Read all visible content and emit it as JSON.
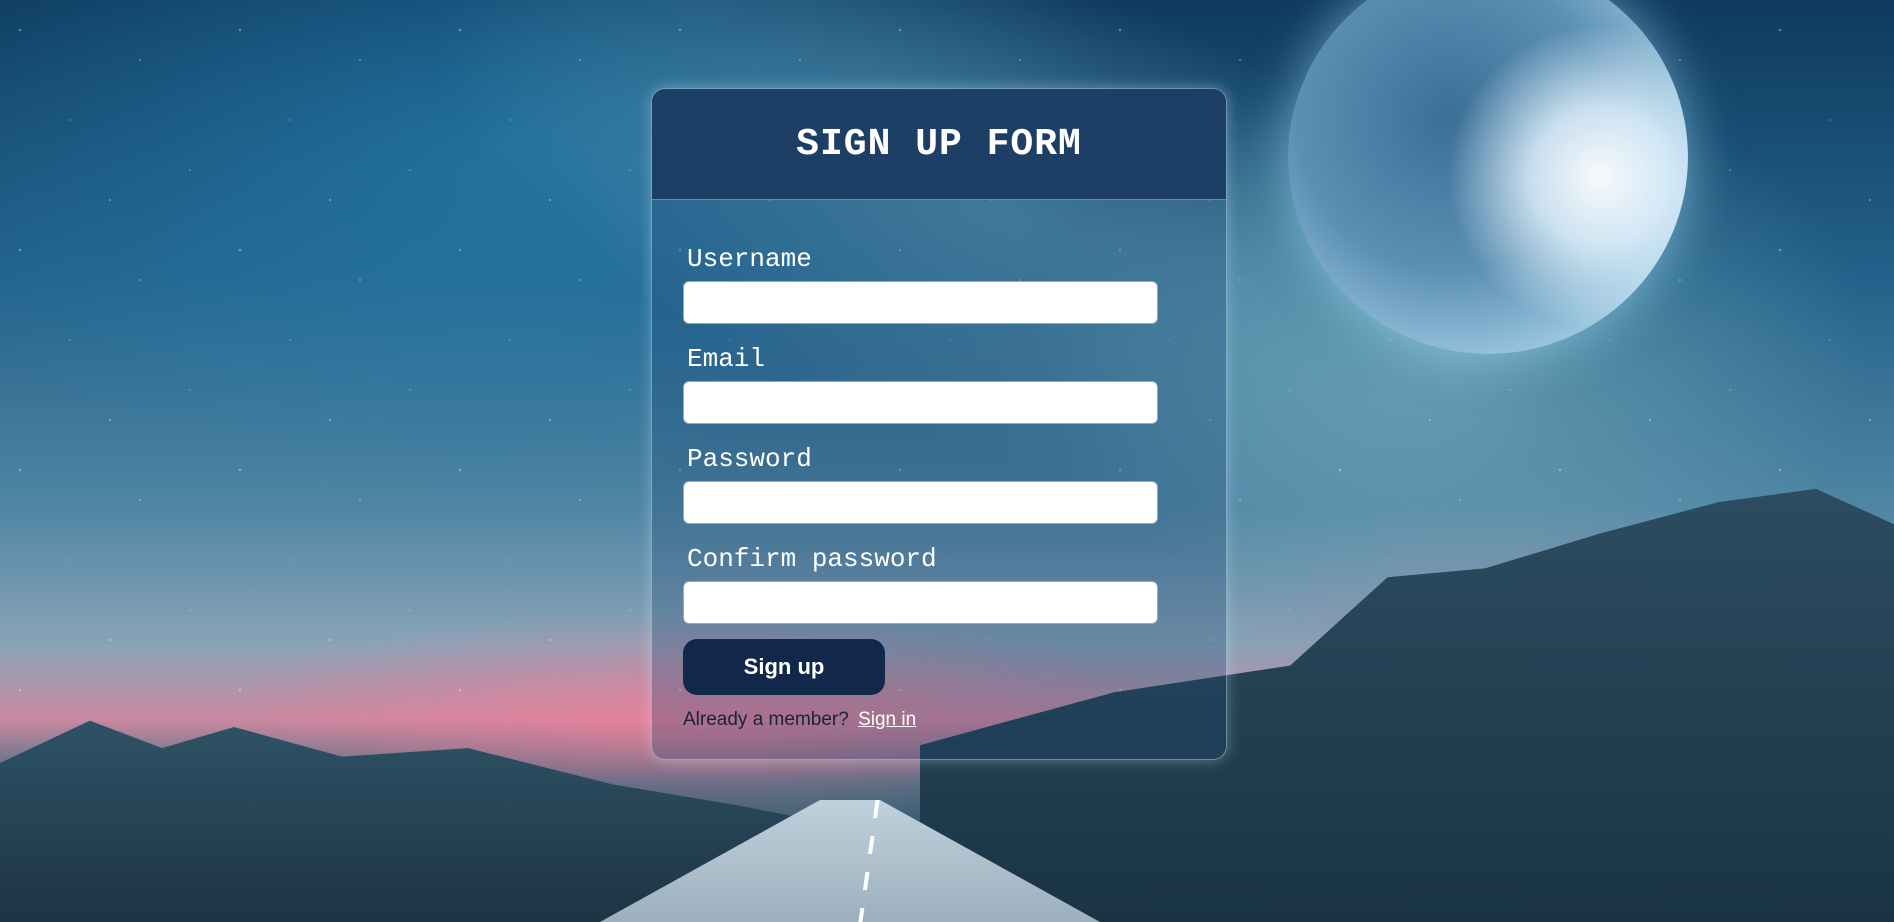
{
  "form": {
    "title": "SIGN UP FORM",
    "fields": [
      {
        "label": "Username",
        "value": ""
      },
      {
        "label": "Email",
        "value": ""
      },
      {
        "label": "Password",
        "value": ""
      },
      {
        "label": "Confirm password",
        "value": ""
      }
    ],
    "submit_label": "Sign up",
    "footer_text": "Already a member?",
    "footer_link": "Sign in"
  },
  "colors": {
    "header_bg": "#1d3f66",
    "button_bg": "#12284a",
    "moon_glow": "#e7f6ff"
  }
}
